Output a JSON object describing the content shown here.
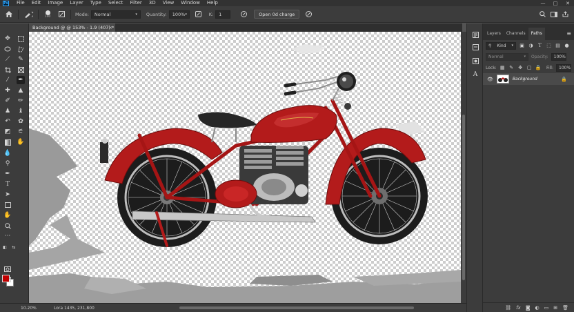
{
  "app": {
    "logo": "Ps"
  },
  "menu": [
    "File",
    "Edit",
    "Image",
    "Layer",
    "Type",
    "Select",
    "Filter",
    "3D",
    "View",
    "Window",
    "Help"
  ],
  "window_controls": [
    "—",
    "□",
    "✕"
  ],
  "options_bar": {
    "brush_size": "100",
    "mode_label": "Mode:",
    "mode_value": "Normal",
    "quantity_label": "Quantity:",
    "quantity_value": "100%",
    "k_label": "K:",
    "k_value": "1",
    "action_button": "Open 0d charge"
  },
  "document_tab": {
    "title": "Background @ @ 153% - 1.9 (407) *",
    "close": "×"
  },
  "status": {
    "zoom": "10.20%",
    "info": "Lora 1435, 231,800"
  },
  "layers_panel": {
    "tabs": [
      "Layers",
      "Channels",
      "Paths"
    ],
    "active_tab": "Paths",
    "kind_label": "Kind",
    "blend_mode": "Normal",
    "opacity_label": "Opacity:",
    "opacity_value": "100%",
    "lock_label": "Lock:",
    "fill_label": "Fill:",
    "fill_value": "100%",
    "layers": [
      {
        "name": "Background",
        "visible": true,
        "locked": true
      }
    ]
  },
  "colors": {
    "foreground": "#c00000",
    "background": "#ffffff",
    "motorcycle_body": "#b31b1b"
  },
  "icons": {
    "toolbar": [
      "move-icon",
      "marquee-icon",
      "lasso-icon",
      "magic-wand-icon",
      "crop-icon",
      "frame-icon",
      "eyedropper-icon",
      "pen-icon",
      "healing-brush-icon",
      "brush-icon",
      "clone-stamp-icon",
      "history-brush-icon",
      "eraser-icon",
      "gradient-icon",
      "blur-icon",
      "dodge-icon",
      "path-selection-icon",
      "type-icon",
      "shape-icon",
      "hand-icon",
      "zoom-icon",
      "edit-toolbar-icon"
    ]
  }
}
